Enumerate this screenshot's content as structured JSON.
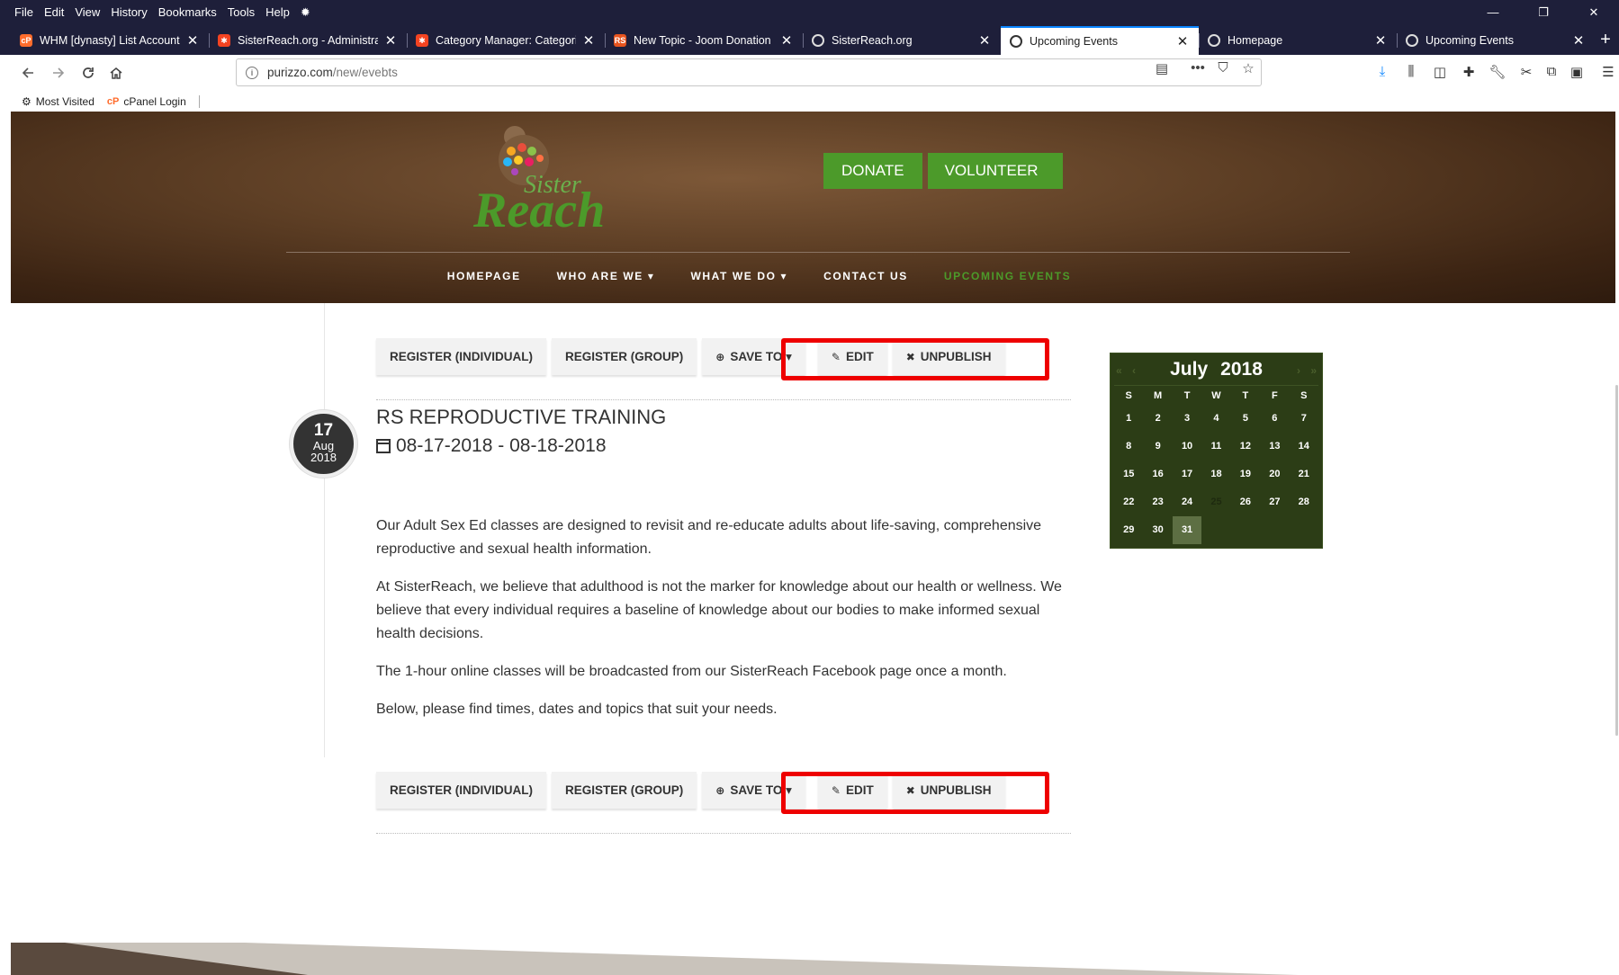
{
  "browser": {
    "menu": [
      "File",
      "Edit",
      "View",
      "History",
      "Bookmarks",
      "Tools",
      "Help"
    ],
    "window_controls": [
      "—",
      "❐",
      "✕"
    ],
    "tabs": [
      {
        "title": "WHM [dynasty] List Accounts",
        "favicon": "cpanel-icon",
        "color": "#ff6c2c",
        "active": false
      },
      {
        "title": "SisterReach.org - Administrati",
        "favicon": "joomla-icon",
        "color": "#f44321",
        "active": false
      },
      {
        "title": "Category Manager: Categories",
        "favicon": "joomla-icon",
        "color": "#f44321",
        "active": false
      },
      {
        "title": "New Topic - Joom Donation -",
        "favicon": "rs-icon",
        "color": "#e8541e",
        "active": false
      },
      {
        "title": "SisterReach.org",
        "favicon": "page-icon",
        "color": "#333333",
        "active": false
      },
      {
        "title": "Upcoming Events",
        "favicon": "page-icon",
        "color": "#333333",
        "active": true
      },
      {
        "title": "Homepage",
        "favicon": "page-icon",
        "color": "#333333",
        "active": false
      },
      {
        "title": "Upcoming Events",
        "favicon": "page-icon",
        "color": "#333333",
        "active": false
      }
    ],
    "url": {
      "host": "purizzo.com",
      "path": "/new/evebts"
    },
    "bookmarks": [
      {
        "label": "Most Visited",
        "icon": "gear-icon"
      },
      {
        "label": "cPanel Login",
        "icon": "cpanel-icon"
      }
    ]
  },
  "site": {
    "logo": {
      "line1": "Sister",
      "line2": "Reach"
    },
    "cta": {
      "donate": "DONATE",
      "volunteer": "VOLUNTEER"
    },
    "nav": [
      {
        "label": "HOMEPAGE",
        "active": false
      },
      {
        "label": "WHO ARE WE ▾",
        "active": false
      },
      {
        "label": "WHAT WE DO ▾",
        "active": false
      },
      {
        "label": "CONTACT US",
        "active": false
      },
      {
        "label": "UPCOMING EVENTS",
        "active": true
      }
    ],
    "accent_green": "#4c9a2a",
    "header_brown": "#5e3f25"
  },
  "actions": {
    "register_individual": "REGISTER (INDIVIDUAL)",
    "register_group": "REGISTER (GROUP)",
    "save_to": "SAVE TO ▾",
    "edit": "EDIT",
    "unpublish": "UNPUBLISH"
  },
  "event": {
    "badge": {
      "day": "17",
      "month": "Aug",
      "year": "2018"
    },
    "title": "RS REPRODUCTIVE TRAINING",
    "dates": "08-17-2018 - 08-18-2018",
    "paragraphs": [
      "Our Adult Sex Ed classes are designed to revisit and re-educate adults about life-saving, comprehensive reproductive and sexual health information.",
      "At SisterReach, we believe that adulthood is not the marker for knowledge about our health or wellness. We believe that every individual requires a baseline of knowledge about our bodies to make informed sexual health decisions.",
      "The 1-hour online classes will be broadcasted from our SisterReach Facebook page once a month.",
      "Below, please find times, dates and topics that suit your needs."
    ]
  },
  "calendar": {
    "month": "July",
    "year": "2018",
    "nav": {
      "prev_year": "«",
      "prev_month": "‹",
      "next_month": "›",
      "next_year": "»"
    },
    "dow": [
      "S",
      "M",
      "T",
      "W",
      "T",
      "F",
      "S"
    ],
    "days": [
      "1",
      "2",
      "3",
      "4",
      "5",
      "6",
      "7",
      "8",
      "9",
      "10",
      "11",
      "12",
      "13",
      "14",
      "15",
      "16",
      "17",
      "18",
      "19",
      "20",
      "21",
      "22",
      "23",
      "24",
      "25",
      "26",
      "27",
      "28",
      "29",
      "30",
      "31"
    ],
    "muted_day": "25",
    "today": "31"
  }
}
